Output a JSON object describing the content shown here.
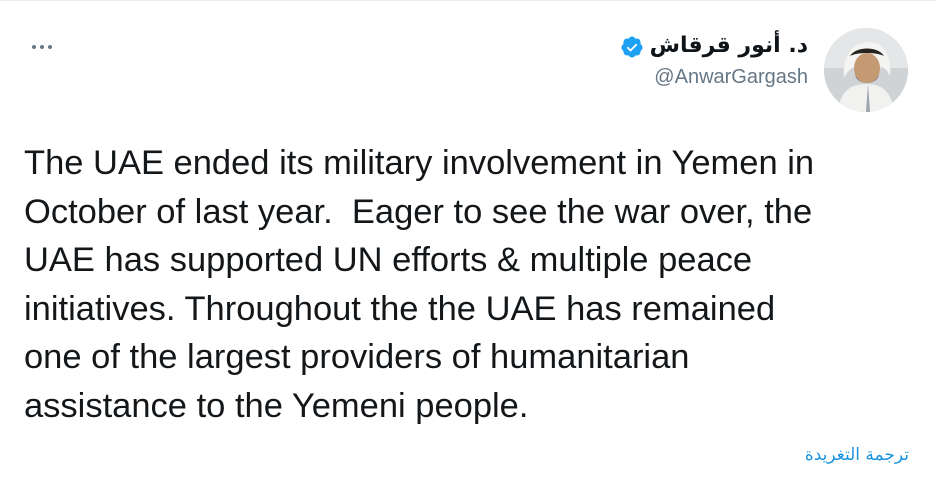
{
  "tweet": {
    "author": {
      "display_name": "د. أنور قرقاش",
      "handle": "@AnwarGargash",
      "verified": true,
      "verified_icon": "verified-badge-icon",
      "avatar": "avatar"
    },
    "more_icon": "more-options-icon",
    "text_lines": [
      "The UAE ended its military involvement in Yemen in",
      "October of last year.  Eager to see the war over, the",
      "UAE has supported UN efforts & multiple peace",
      "initiatives. Throughout the the UAE has remained",
      "one of the largest providers of humanitarian",
      "assistance to the Yemeni people."
    ],
    "translate_label": "ترجمة التغريدة"
  },
  "colors": {
    "link": "#1b95e0",
    "secondary_text": "#657786",
    "verified": "#1da1f2",
    "border": "#e6ecf0"
  }
}
